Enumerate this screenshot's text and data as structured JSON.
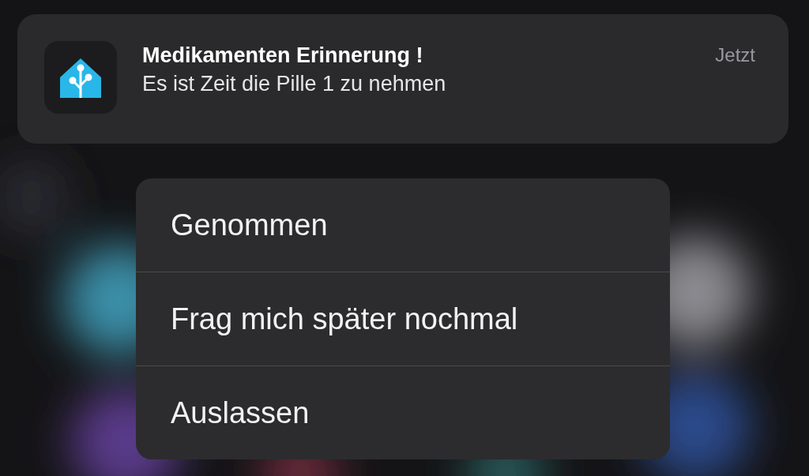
{
  "notification": {
    "title": "Medikamenten Erinnerung !",
    "body": "Es ist Zeit die Pille 1 zu nehmen",
    "time": "Jetzt"
  },
  "actions": [
    {
      "label": "Genommen"
    },
    {
      "label": "Frag mich später nochmal"
    },
    {
      "label": "Auslassen"
    }
  ]
}
